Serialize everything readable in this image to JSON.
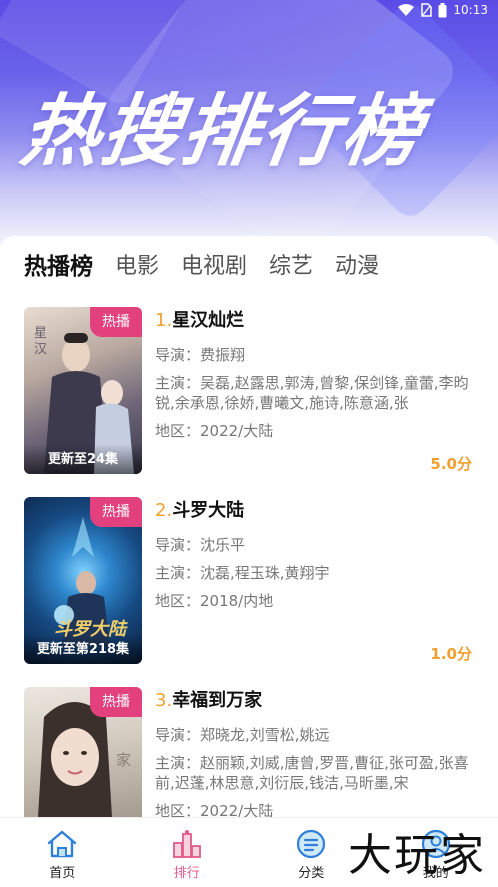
{
  "status_bar": {
    "time": "10:13"
  },
  "banner": {
    "title": "热搜排行榜"
  },
  "tabs": [
    {
      "label": "热播榜",
      "active": true
    },
    {
      "label": "电影",
      "active": false
    },
    {
      "label": "电视剧",
      "active": false
    },
    {
      "label": "综艺",
      "active": false
    },
    {
      "label": "动漫",
      "active": false
    }
  ],
  "items": [
    {
      "rank": "1.",
      "title": "星汉灿烂",
      "badge": "热播",
      "episodes": "更新至24集",
      "director": "导演：费振翔",
      "cast": "主演：吴磊,赵露思,郭涛,曾黎,保剑锋,童蕾,李昀锐,余承恩,徐娇,曹曦文,施诗,陈意涵,张",
      "region": "地区：2022/大陆",
      "score": "5.0分",
      "poster_colors": [
        "#c8b6a6",
        "#8a7d88",
        "#3a3f55"
      ]
    },
    {
      "rank": "2.",
      "title": "斗罗大陆",
      "badge": "热播",
      "episodes": "更新至第218集",
      "director": "导演：沈乐平",
      "cast": "主演：沈磊,程玉珠,黄翔宇",
      "region": "地区：2018/内地",
      "score": "1.0分",
      "poster_colors": [
        "#1a4f88",
        "#2b8bd1",
        "#0d2245"
      ]
    },
    {
      "rank": "3.",
      "title": "幸福到万家",
      "badge": "热播",
      "episodes": "",
      "director": "导演：郑晓龙,刘雪松,姚远",
      "cast": "主演：赵丽颖,刘威,唐曾,罗晋,曹征,张可盈,张喜前,迟蓬,林思意,刘衍辰,钱洁,马昕墨,宋",
      "region": "地区：2022/大陆",
      "score": "",
      "poster_colors": [
        "#d9d2c8",
        "#b7aca0",
        "#6f6660"
      ]
    }
  ],
  "bottom_nav": [
    {
      "label": "首页",
      "icon": "home-icon",
      "active": false
    },
    {
      "label": "排行",
      "icon": "ranking-icon",
      "active": true
    },
    {
      "label": "分类",
      "icon": "category-icon",
      "active": false
    },
    {
      "label": "我的",
      "icon": "profile-icon",
      "active": false
    }
  ],
  "watermark": "大玩家",
  "colors": {
    "accent_pink": "#e2417e",
    "score_orange": "#f0a030",
    "banner_purple": "#5a4be6",
    "nav_blue": "#2f7fd8"
  }
}
